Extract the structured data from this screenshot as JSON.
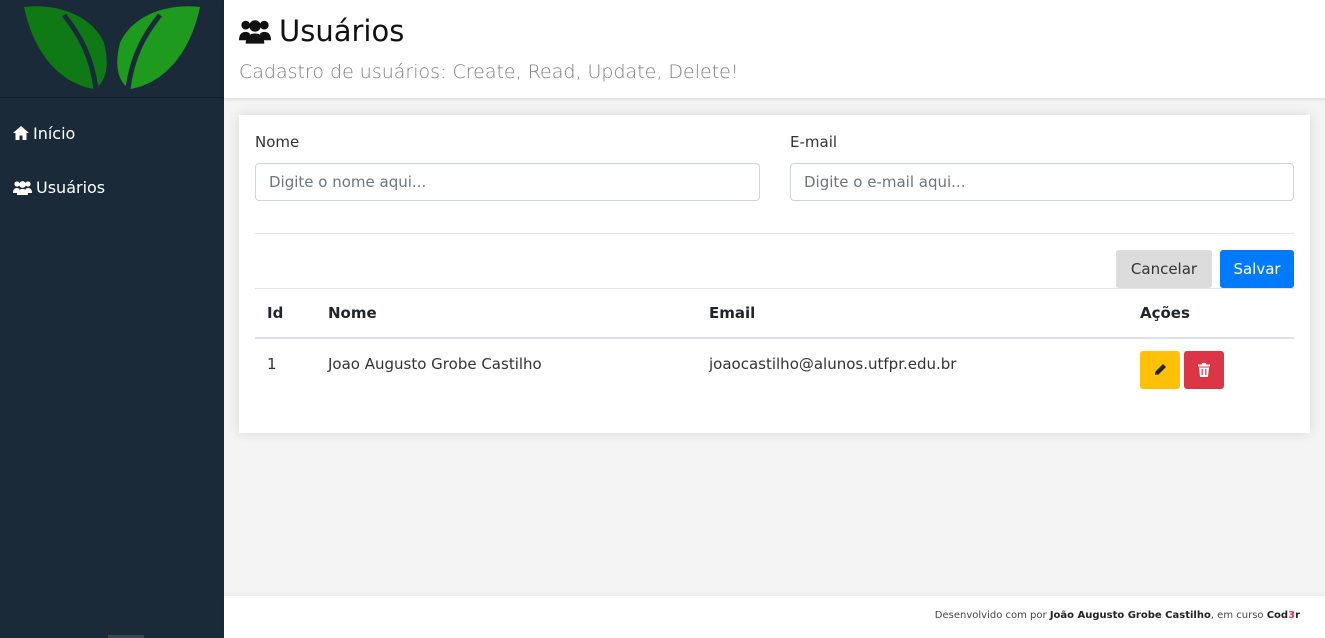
{
  "sidebar": {
    "items": [
      {
        "label": "Início",
        "icon": "home-icon"
      },
      {
        "label": "Usuários",
        "icon": "users-icon"
      }
    ]
  },
  "header": {
    "title": "Usuários",
    "subtitle": "Cadastro de usuários: Create, Read, Update, Delete!"
  },
  "form": {
    "name_label": "Nome",
    "name_placeholder": "Digite o nome aqui...",
    "email_label": "E-mail",
    "email_placeholder": "Digite o e-mail aqui...",
    "cancel_label": "Cancelar",
    "save_label": "Salvar"
  },
  "table": {
    "headers": [
      "Id",
      "Nome",
      "Email",
      "Ações"
    ],
    "rows": [
      {
        "id": "1",
        "nome": "Joao Augusto Grobe Castilho",
        "email": "joaocastilho@alunos.utfpr.edu.br"
      }
    ]
  },
  "footer": {
    "prefix": "Desenvolvido com ",
    "by": "por ",
    "author": "João Augusto Grobe Castilho",
    "middle": ", em curso ",
    "brand_a": "Cod",
    "brand_b": "3",
    "brand_c": "r"
  },
  "colors": {
    "sidebar": "#1b2a38",
    "primary": "#007bff",
    "warning": "#ffc107",
    "danger": "#dc3545",
    "logo": "#1e9a1e"
  }
}
